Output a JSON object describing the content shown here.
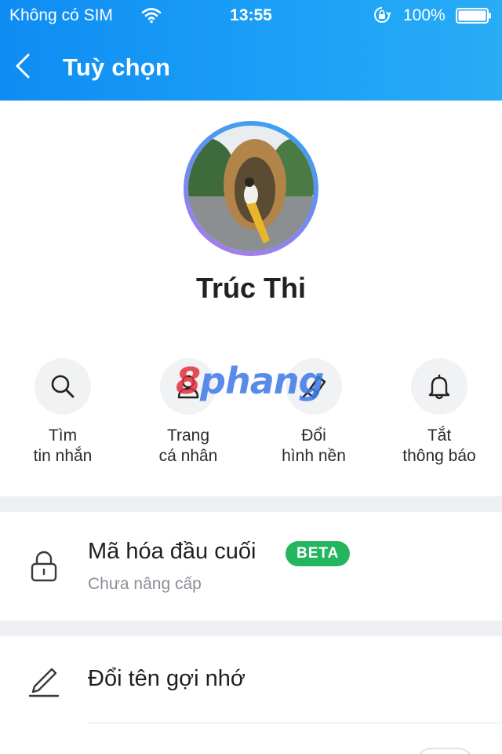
{
  "status_bar": {
    "carrier": "Không có SIM",
    "time": "13:55",
    "battery_percent": "100%",
    "icons": [
      "wifi-icon",
      "orientation-lock-icon",
      "battery-icon"
    ]
  },
  "nav": {
    "title": "Tuỳ chọn",
    "back_icon": "chevron-left-icon"
  },
  "profile": {
    "name": "Trúc Thi"
  },
  "actions": [
    {
      "icon": "search-icon",
      "line1": "Tìm",
      "line2": "tin nhắn"
    },
    {
      "icon": "person-icon",
      "line1": "Trang",
      "line2": "cá nhân"
    },
    {
      "icon": "paintbrush-icon",
      "line1": "Đổi",
      "line2": "hình nền"
    },
    {
      "icon": "bell-icon",
      "line1": "Tắt",
      "line2": "thông báo"
    }
  ],
  "encryption": {
    "title": "Mã hóa đầu cuối",
    "badge": "BETA",
    "subtitle": "Chưa nâng cấp",
    "icon": "lock-icon"
  },
  "rename": {
    "label": "Đổi tên gợi nhớ",
    "icon": "pencil-icon"
  },
  "watermark": {
    "part1": "8",
    "part2": "phang"
  },
  "colors": {
    "header": "#1a9bf5",
    "beta_badge": "#23b65e",
    "separator": "#eef0f3",
    "subtitle": "#8a8f96"
  }
}
